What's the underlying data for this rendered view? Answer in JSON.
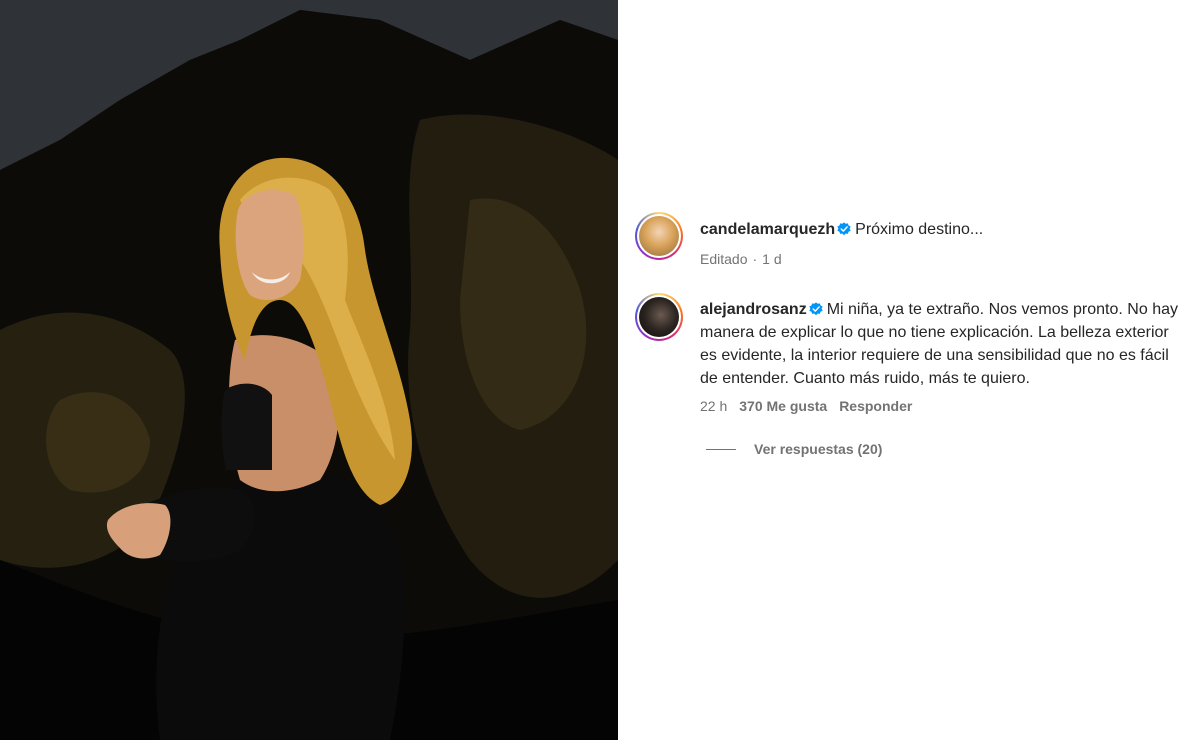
{
  "post": {
    "author": "candelamarquezh",
    "caption": "Próximo destino...",
    "edited_label": "Editado",
    "time": "1 d",
    "separator": "·"
  },
  "comment": {
    "author": "alejandrosanz",
    "text": "Mi niña, ya te extraño. Nos vemos pronto. No hay manera de explicar lo que no tiene explicación. La belleza exterior es evidente, la interior requiere de una sensibilidad que no es fácil de entender. Cuanto más ruido, más te quiero.",
    "time": "22 h",
    "likes": "370 Me gusta",
    "reply_label": "Responder",
    "view_replies": "Ver respuestas (20)"
  },
  "colors": {
    "verified": "#0095f6",
    "secondary_text": "#737373",
    "primary_text": "#262626"
  },
  "icons": {
    "verified": "verified-badge-icon"
  }
}
